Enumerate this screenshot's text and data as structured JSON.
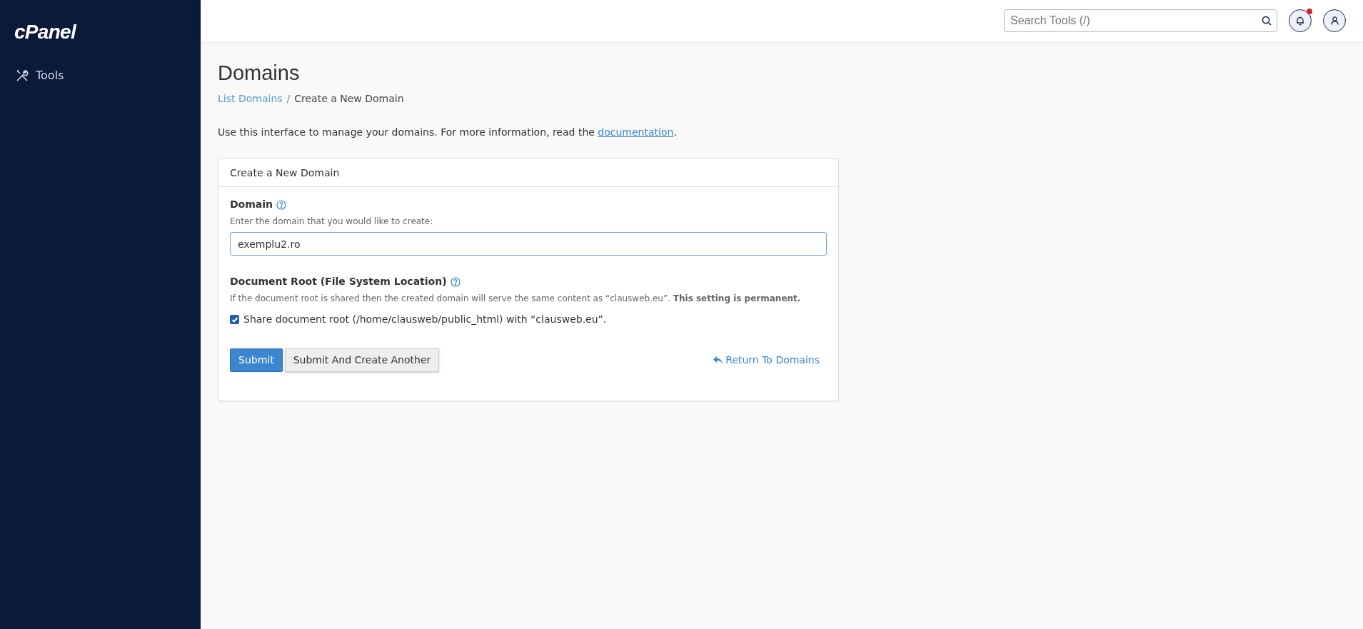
{
  "sidebar": {
    "logo": "cPanel",
    "items": [
      {
        "label": "Tools",
        "selected": false
      }
    ]
  },
  "topbar": {
    "search": {
      "placeholder": "Search Tools (/)"
    },
    "notifications": {
      "unread": true
    }
  },
  "page": {
    "title": "Domains",
    "breadcrumb_separator": "/",
    "breadcrumb": [
      {
        "label": "List Domains",
        "kind": "link"
      },
      {
        "label": "Create a New Domain",
        "kind": "current"
      }
    ],
    "intro": {
      "text": "Use this interface to manage your domains. For more information, read the ",
      "link": "documentation",
      "after": "."
    }
  },
  "card": {
    "title": "Create a New Domain",
    "domain": {
      "label": "Domain",
      "hint": "Enter the domain that you would like to create:",
      "value": "exemplu2.ro"
    },
    "document_root": {
      "label": "Document Root (File System Location)",
      "hint": "If the document root is shared then the created domain will serve the same content as “clausweb.eu”. **This setting is permanent.**",
      "checkbox": {
        "label": "Share document root (/home/clausweb/public_html) with “clausweb.eu”.",
        "checked": true
      }
    },
    "buttons": [
      {
        "label": "Submit",
        "kind": "primary"
      },
      {
        "label": "Submit And Create Another",
        "kind": "secondary"
      }
    ],
    "return_link": "Return To Domains"
  }
}
